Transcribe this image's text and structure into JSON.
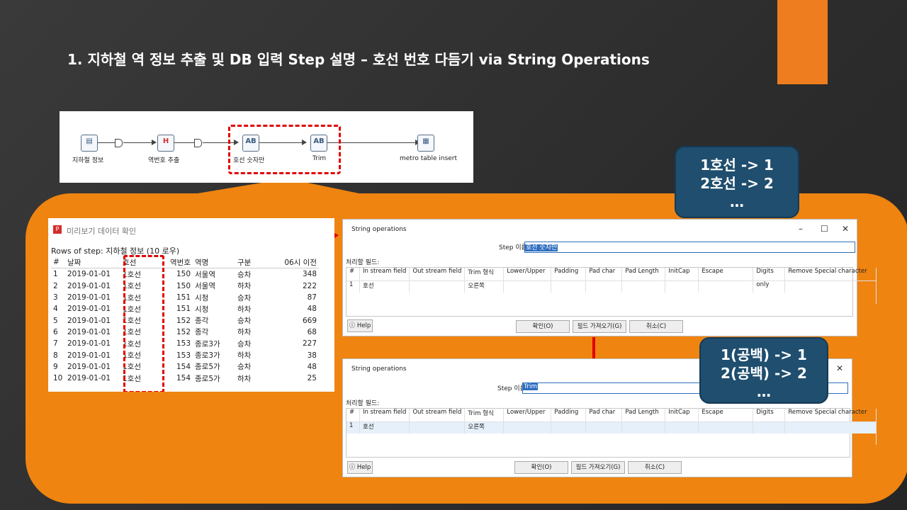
{
  "slide": {
    "title": "1. 지하철 역 정보 추출 및 DB 입력 Step 설명 – 호선 번호 다듬기 via String Operations",
    "accent_color": "#ED7D1E",
    "panel_color": "#EF8410"
  },
  "flow": {
    "steps": [
      {
        "label": "지하철 정보",
        "icon": "input-file-icon"
      },
      {
        "label": "역번호 추출",
        "icon": "split-field-icon",
        "glyph": "H"
      },
      {
        "label": "호선 숫자만",
        "icon": "string-ops-icon",
        "glyph": "AB"
      },
      {
        "label": "Trim",
        "icon": "string-ops-icon",
        "glyph": "AB"
      },
      {
        "label": "metro table insert",
        "icon": "table-output-icon"
      }
    ]
  },
  "preview": {
    "title": "미리보기 데이터 확인",
    "rows_label": "Rows of step: 지하철 정보 (10 로우)",
    "columns": [
      "#",
      "날짜",
      "호선",
      "역번호",
      "역명",
      "구분",
      "06시 이전"
    ],
    "rows": [
      [
        "1",
        "2019-01-01",
        "1호선",
        "150",
        "서울역",
        "승차",
        "348"
      ],
      [
        "2",
        "2019-01-01",
        "1호선",
        "150",
        "서울역",
        "하차",
        "222"
      ],
      [
        "3",
        "2019-01-01",
        "1호선",
        "151",
        "시청",
        "승차",
        "87"
      ],
      [
        "4",
        "2019-01-01",
        "1호선",
        "151",
        "시청",
        "하차",
        "48"
      ],
      [
        "5",
        "2019-01-01",
        "1호선",
        "152",
        "종각",
        "승차",
        "669"
      ],
      [
        "6",
        "2019-01-01",
        "1호선",
        "152",
        "종각",
        "하차",
        "68"
      ],
      [
        "7",
        "2019-01-01",
        "1호선",
        "153",
        "종로3가",
        "승차",
        "227"
      ],
      [
        "8",
        "2019-01-01",
        "1호선",
        "153",
        "종로3가",
        "하차",
        "38"
      ],
      [
        "9",
        "2019-01-01",
        "1호선",
        "154",
        "종로5가",
        "승차",
        "48"
      ],
      [
        "10",
        "2019-01-01",
        "1호선",
        "154",
        "종로5가",
        "하차",
        "25"
      ]
    ]
  },
  "dialog1": {
    "title": "String operations",
    "step_name_label": "Step 이름",
    "step_name_value": "호선 숫자만",
    "fields_label": "처리할 필드:",
    "columns": [
      "#",
      "In stream field",
      "Out stream field",
      "Trim 형식",
      "Lower/Upper",
      "Padding",
      "Pad char",
      "Pad Length",
      "InitCap",
      "Escape",
      "Digits",
      "Remove Special character"
    ],
    "row": [
      "1",
      "호선",
      "",
      "오른쪽",
      "",
      "",
      "",
      "",
      "",
      "",
      "only",
      ""
    ],
    "help": "Help",
    "ok": "확인(O)",
    "get_fields": "필드 가져오기(G)",
    "cancel": "취소(C)"
  },
  "dialog2": {
    "title": "String operations",
    "step_name_label": "Step 이름",
    "step_name_value": "Trim",
    "fields_label": "처리할 필드:",
    "columns": [
      "#",
      "In stream field",
      "Out stream field",
      "Trim 형식",
      "Lower/Upper",
      "Padding",
      "Pad char",
      "Pad Length",
      "InitCap",
      "Escape",
      "Digits",
      "Remove Special character"
    ],
    "row": [
      "1",
      "호선",
      "",
      "오른쪽",
      "",
      "",
      "",
      "",
      "",
      "",
      "",
      ""
    ],
    "help": "Help",
    "ok": "확인(O)",
    "get_fields": "필드 가져오기(G)",
    "cancel": "취소(C)"
  },
  "callout1": {
    "line1": "1호선 -> 1",
    "line2": "2호선 -> 2",
    "line3": "…"
  },
  "callout2": {
    "line1": "1(공백) -> 1",
    "line2": "2(공백) -> 2",
    "line3": "…"
  }
}
